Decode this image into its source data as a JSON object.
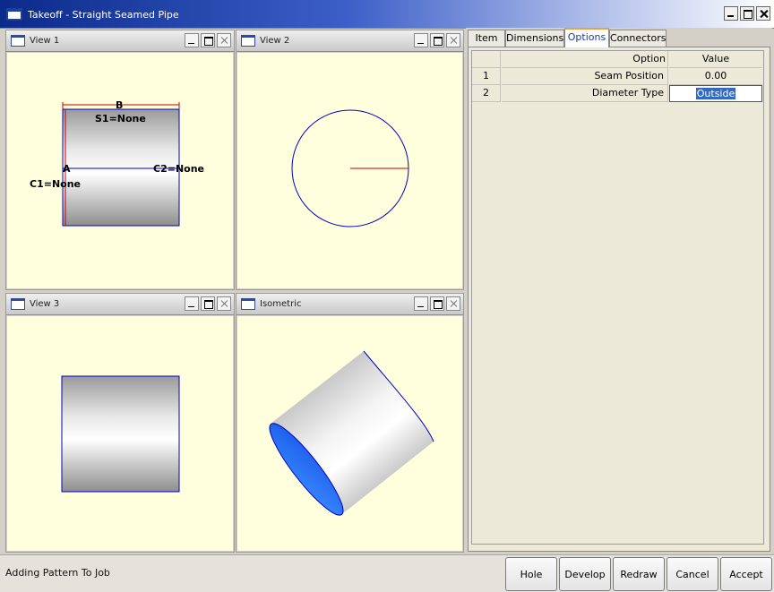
{
  "window": {
    "title": "Takeoff - Straight Seamed Pipe"
  },
  "views": [
    {
      "title": "View 1"
    },
    {
      "title": "View 2"
    },
    {
      "title": "View 3"
    },
    {
      "title": "Isometric"
    }
  ],
  "view1_labels": {
    "b": "B",
    "s1": "S1=None",
    "a": "A",
    "c2": "C2=None",
    "c1": "C1=None"
  },
  "tabs": [
    {
      "label": "Item",
      "active": false
    },
    {
      "label": "Dimensions",
      "active": false
    },
    {
      "label": "Options",
      "active": true
    },
    {
      "label": "Connectors",
      "active": false
    }
  ],
  "options_grid": {
    "headers": {
      "option": "Option",
      "value": "Value"
    },
    "rows": [
      {
        "num": "1",
        "option": "Seam Position",
        "value": "0.00"
      },
      {
        "num": "2",
        "option": "Diameter Type",
        "value": "Outside"
      }
    ]
  },
  "status": {
    "text": "Adding Pattern To Job"
  },
  "actions": {
    "hole": "Hole",
    "develop": "Develop",
    "redraw": "Redraw",
    "cancel": "Cancel",
    "accept": "Accept"
  },
  "colors": {
    "canvas_bg": "#ffffdd",
    "outline_blue": "#0000cc",
    "dimension_red": "#cc0000",
    "selection_blue": "#316ac5"
  }
}
